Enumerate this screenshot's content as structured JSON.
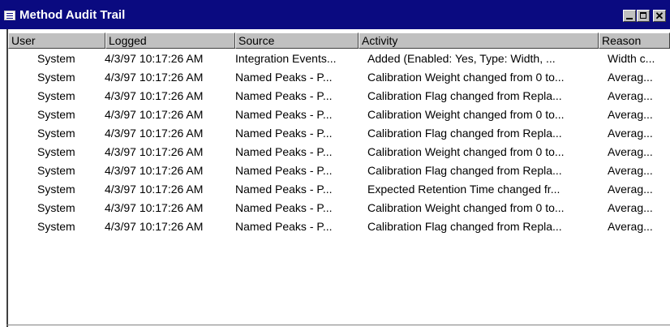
{
  "window": {
    "title": "Method Audit Trail",
    "icon": "window-menu-icon",
    "controls": [
      "minimize-icon",
      "maximize-icon",
      "close-icon"
    ]
  },
  "table": {
    "columns": [
      "User",
      "Logged",
      "Source",
      "Activity",
      "Reason"
    ],
    "rows": [
      [
        "System",
        "4/3/97 10:17:26 AM",
        "Integration Events...",
        "Added (Enabled: Yes, Type: Width, ...",
        "Width c..."
      ],
      [
        "System",
        "4/3/97 10:17:26 AM",
        "Named Peaks - P...",
        "Calibration Weight changed from 0 to...",
        "Averag..."
      ],
      [
        "System",
        "4/3/97 10:17:26 AM",
        "Named Peaks - P...",
        "Calibration Flag changed from Repla...",
        "Averag..."
      ],
      [
        "System",
        "4/3/97 10:17:26 AM",
        "Named Peaks - P...",
        "Calibration Weight changed from 0 to...",
        "Averag..."
      ],
      [
        "System",
        "4/3/97 10:17:26 AM",
        "Named Peaks - P...",
        "Calibration Flag changed from Repla...",
        "Averag..."
      ],
      [
        "System",
        "4/3/97 10:17:26 AM",
        "Named Peaks - P...",
        "Calibration Weight changed from 0 to...",
        "Averag..."
      ],
      [
        "System",
        "4/3/97 10:17:26 AM",
        "Named Peaks - P...",
        "Calibration Flag changed from Repla...",
        "Averag..."
      ],
      [
        "System",
        "4/3/97 10:17:26 AM",
        "Named Peaks - P...",
        "Expected Retention Time changed fr...",
        "Averag..."
      ],
      [
        "System",
        "4/3/97 10:17:26 AM",
        "Named Peaks - P...",
        "Calibration Weight changed from 0 to...",
        "Averag..."
      ],
      [
        "System",
        "4/3/97 10:17:26 AM",
        "Named Peaks - P...",
        "Calibration Flag changed from Repla...",
        "Averag..."
      ]
    ]
  },
  "colors": {
    "titlebar": "#0a0a80",
    "face": "#c0c0c0"
  }
}
